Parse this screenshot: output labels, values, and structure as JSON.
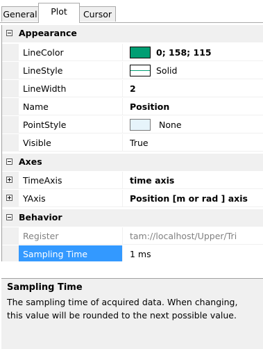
{
  "tabs": [
    {
      "label": "General"
    },
    {
      "label": "Plot",
      "selected": true
    },
    {
      "label": "Cursor"
    }
  ],
  "grid": {
    "appearance": {
      "label": "Appearance",
      "line_color": {
        "name": "LineColor",
        "value": "0; 158; 115",
        "swatch": "#009e73"
      },
      "line_style": {
        "name": "LineStyle",
        "value": "Solid"
      },
      "line_width": {
        "name": "LineWidth",
        "value": "2"
      },
      "name": {
        "name": "Name",
        "value": "Position"
      },
      "point_style": {
        "name": "PointStyle",
        "value": "None"
      },
      "visible": {
        "name": "Visible",
        "value": "True"
      }
    },
    "axes": {
      "label": "Axes",
      "time_axis": {
        "name": "TimeAxis",
        "value": "time axis"
      },
      "y_axis": {
        "name": "YAxis",
        "value": "Position [m or rad ] axis"
      }
    },
    "behavior": {
      "label": "Behavior",
      "register": {
        "name": "Register",
        "value": "tam://localhost/Upper/Tri"
      },
      "sampling_time": {
        "name": "Sampling Time",
        "value": "1 ms"
      }
    }
  },
  "help": {
    "title": "Sampling Time",
    "description": "The sampling time of acquired data. When changing, this value will be rounded to the next possible value."
  },
  "colors": {
    "selection": "#3399ff",
    "category_bg": "#f0f0f0"
  }
}
